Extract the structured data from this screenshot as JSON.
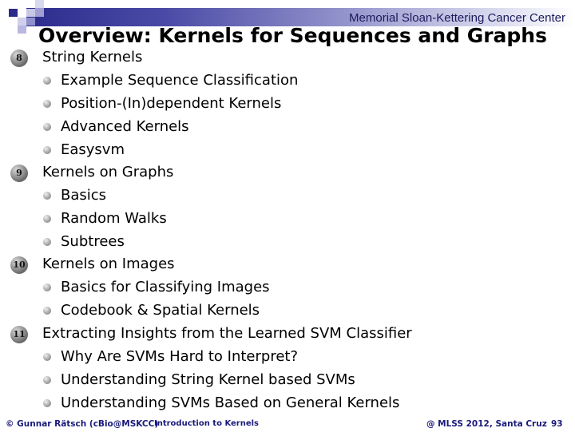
{
  "header": {
    "organization": "Memorial Sloan-Kettering Cancer Center"
  },
  "slide": {
    "title": "Overview: Kernels for Sequences and Graphs",
    "sections": [
      {
        "number": "8",
        "label": "String Kernels",
        "items": [
          "Example Sequence Classification",
          "Position-(In)dependent Kernels",
          "Advanced Kernels",
          "Easysvm"
        ]
      },
      {
        "number": "9",
        "label": "Kernels on Graphs",
        "items": [
          "Basics",
          "Random Walks",
          "Subtrees"
        ]
      },
      {
        "number": "10",
        "label": "Kernels on Images",
        "items": [
          "Basics for Classifying Images",
          "Codebook & Spatial Kernels"
        ]
      },
      {
        "number": "11",
        "label": "Extracting Insights from the Learned SVM Classifier",
        "items": [
          "Why Are SVMs Hard to Interpret?",
          "Understanding String Kernel based SVMs",
          "Understanding SVMs Based on General Kernels"
        ]
      }
    ]
  },
  "footer": {
    "author": "© Gunnar Rätsch (cBio@MSKCC)",
    "talk": "Introduction to Kernels",
    "event": "@ MLSS 2012, Santa Cruz",
    "page": "93"
  },
  "colors": {
    "header_dark": "#2c2c8e",
    "footer_blue": "#1a1a7a"
  }
}
